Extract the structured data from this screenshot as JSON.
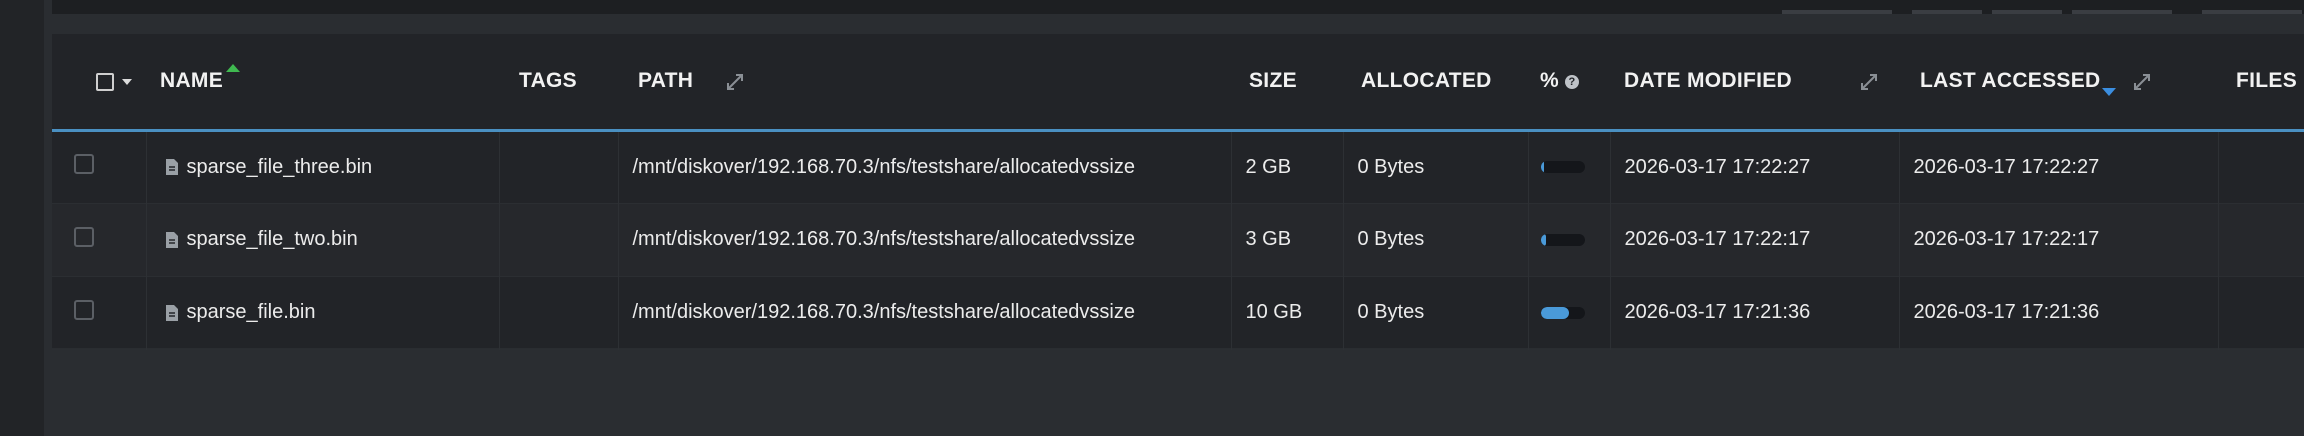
{
  "table": {
    "columns": [
      {
        "key": "name",
        "label": "NAME"
      },
      {
        "key": "tags",
        "label": "TAGS"
      },
      {
        "key": "path",
        "label": "PATH"
      },
      {
        "key": "size",
        "label": "SIZE"
      },
      {
        "key": "allocated",
        "label": "ALLOCATED"
      },
      {
        "key": "pct",
        "label": "%"
      },
      {
        "key": "date_modified",
        "label": "DATE MODIFIED"
      },
      {
        "key": "last_accessed",
        "label": "LAST ACCESSED"
      },
      {
        "key": "files",
        "label": "FILES"
      }
    ],
    "rows": [
      {
        "name": "sparse_file_three.bin",
        "tags": "",
        "path": "/mnt/diskover/192.168.70.3/nfs/testshare/allocatedvssize",
        "size": "2 GB",
        "allocated": "0 Bytes",
        "pct_fill": 0.08,
        "date_modified": "2026-03-17 17:22:27",
        "last_accessed": "2026-03-17 17:22:27",
        "files": ""
      },
      {
        "name": "sparse_file_two.bin",
        "tags": "",
        "path": "/mnt/diskover/192.168.70.3/nfs/testshare/allocatedvssize",
        "size": "3 GB",
        "allocated": "0 Bytes",
        "pct_fill": 0.12,
        "date_modified": "2026-03-17 17:22:17",
        "last_accessed": "2026-03-17 17:22:17",
        "files": ""
      },
      {
        "name": "sparse_file.bin",
        "tags": "",
        "path": "/mnt/diskover/192.168.70.3/nfs/testshare/allocatedvssize",
        "size": "10 GB",
        "allocated": "0 Bytes",
        "pct_fill": 0.65,
        "date_modified": "2026-03-17 17:21:36",
        "last_accessed": "2026-03-17 17:21:36",
        "files": ""
      }
    ]
  },
  "colors": {
    "accent_blue": "#4a90c2",
    "bar_fill": "#4a9ad9",
    "sort_asc_green": "#3fb950",
    "sort_desc_blue": "#3b8ee0"
  },
  "icons": {
    "file": "file-icon",
    "expand": "expand-icon",
    "help": "help-icon"
  }
}
